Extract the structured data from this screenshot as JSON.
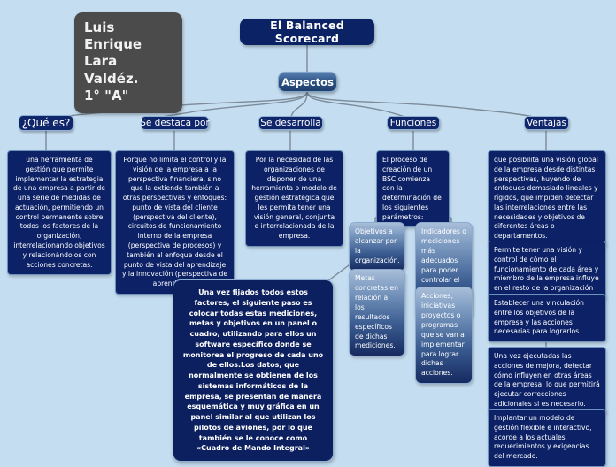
{
  "theme": {
    "background": "#c5ddf0",
    "root_fill": "#0b2265",
    "card_fill": "#0c2166",
    "plaque_fill": "#4b4b4b",
    "border": "#8fb2d4",
    "text": "#ffffff",
    "connector": "#7b8b99"
  },
  "plaque": {
    "name": "Luis Enrique",
    "surname": "Lara Valdéz.",
    "group": "1° \"A\""
  },
  "root": {
    "label": "El Balanced Scorecard"
  },
  "hub": {
    "label": "Aspectos"
  },
  "branches": [
    {
      "id": "que-es",
      "label": "¿Qué es?",
      "cards": [
        "una herramienta de gestión que permite implementar la estrategia de una empresa a partir de una serie de medidas de actuación, permitiendo un control permanente sobre todos los factores de la organización, interrelacionando objetivos y relacionándolos con acciones concretas."
      ]
    },
    {
      "id": "se-destaca-por",
      "label": "Se destaca por",
      "cards": [
        "Porque no limita el control y la visión de la empresa a la perspectiva financiera, sino que la extiende también a otras perspectivas y enfoques: punto de vista del cliente (perspectiva del cliente), circuitos de funcionamiento interno de la empresa (perspectiva de procesos) y también al enfoque desde el punto de vista del aprendizaje y la innovación (perspectiva de aprendizaje)."
      ]
    },
    {
      "id": "se-desarrolla",
      "label": "Se desarrolla",
      "cards": [
        "Por la necesidad de las organizaciones de disponer de una herramienta o modelo de gestión estratégica que les permita tener una visión general, conjunta e interrelacionada de la empresa."
      ]
    },
    {
      "id": "funciones",
      "label": "Funciones",
      "cards": [
        "El proceso de creación de un BSC comienza con la determinación de los siguientes parámetros:"
      ],
      "sub": [
        "Objetivos a alcanzar por la organización.",
        "Indicadores o mediciones más adecuados para poder controlar el grado de alance de los objetivos.",
        "Metas concretas en relación a los resultados específicos de dichas mediciones.",
        "Acciones, iniciativas proyectos o programas que se van a implementar para lograr dichas acciones."
      ]
    },
    {
      "id": "ventajas",
      "label": "Ventajas",
      "cards": [
        "que posibilita una visión global de la empresa desde distintas perspectivas, huyendo de enfoques demasiado lineales y rígidos, que impiden detectar las interrelaciones entre las necesidades y objetivos de diferentes áreas o departamentos.",
        "Permite tener una visión y control de cómo el funcionamiento de cada área y miembro de la empresa influye en el resto de la organización",
        "Establecer una vinculación entre los objetivos de la empresa y las acciones necesarias para lograrlos.",
        "Una vez ejecutadas las acciones de mejora, detectar cómo influyen en otras áreas de la empresa, lo que permitirá ejecutar correcciones adicionales si es necesario.",
        "Implantar un modelo de gestión flexible e interactivo, acorde a los actuales requerimientos y exigencias del mercado."
      ]
    }
  ],
  "summary": {
    "text": "Una vez fijados todos estos factores, el siguiente paso es colocar todas estas mediciones, metas y objetivos en un panel o cuadro, utilizando para ellos un software específico donde se monitorea el progreso de cada uno de ellos.Los datos, que normalmente se obtienen de los sistemas informáticos de la empresa, se presentan de manera esquemática y muy gráfica en un panel similar al que utilizan los pilotos de aviones, por lo que también se le conoce como «Cuadro de Mando Integral»"
  }
}
